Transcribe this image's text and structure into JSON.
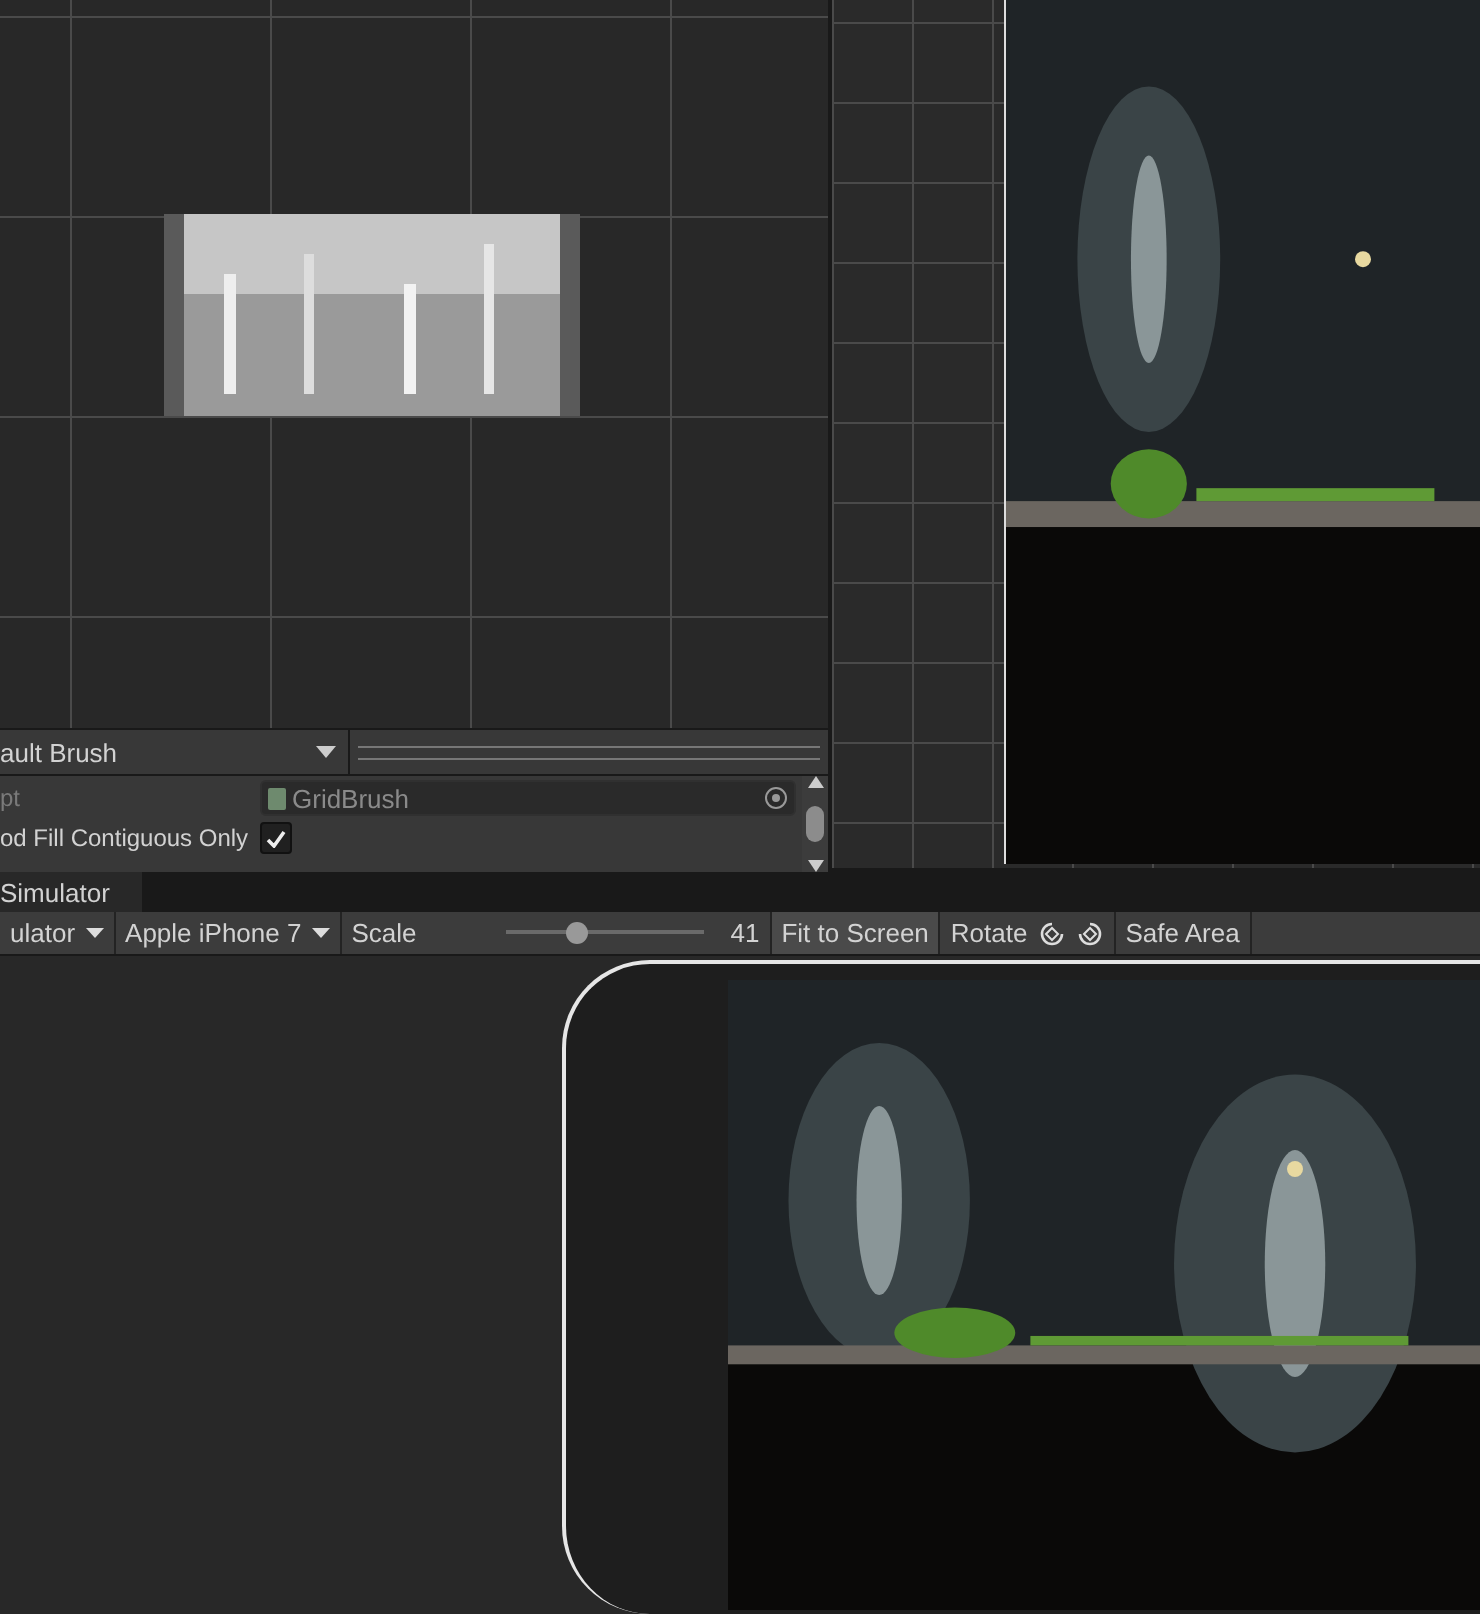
{
  "palette": {
    "brush_dropdown": "ault Brush",
    "rows": [
      {
        "kind": "object",
        "label": "pt",
        "value": "GridBrush"
      },
      {
        "kind": "checkbox",
        "label": "od Fill Contiguous Only",
        "checked": true
      }
    ]
  },
  "simulator": {
    "tab": "Simulator",
    "toolbar": {
      "mode_dropdown": "ulator",
      "device_dropdown": "Apple iPhone 7",
      "scale_label": "Scale",
      "scale": {
        "level": 0.35
      },
      "scale_value": "41",
      "fit_button": "Fit to Screen",
      "rotate_label": "Rotate",
      "safe_area_button": "Safe Area"
    }
  }
}
